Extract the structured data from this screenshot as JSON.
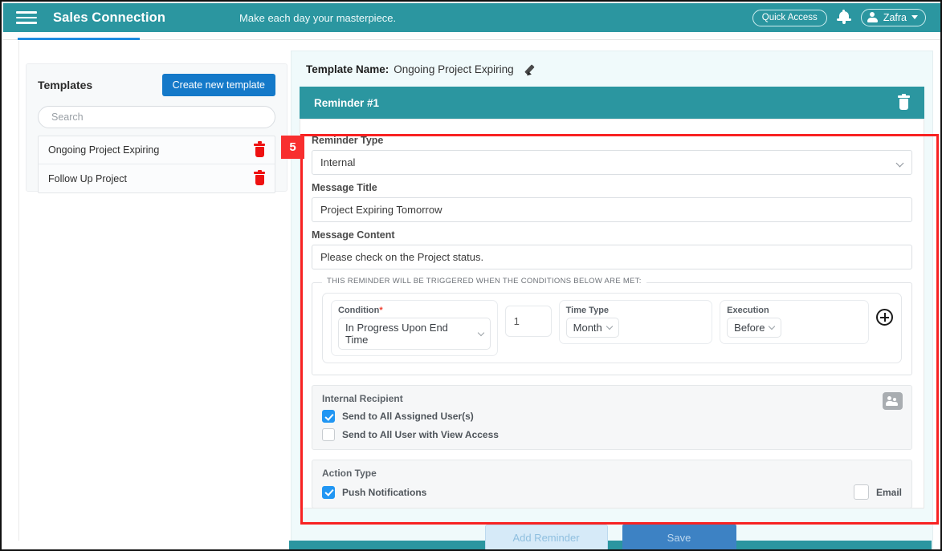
{
  "appbar": {
    "menu_icon": "hamburger-icon",
    "brand": "Sales Connection",
    "tagline": "Make each day your masterpiece.",
    "quick_access": "Quick Access",
    "bell_icon": "notification-bell-icon",
    "user_name": "Zafra",
    "teal": "#2b96a0"
  },
  "tabs": {
    "tab1": "",
    "tab2": ""
  },
  "templates": {
    "title": "Templates",
    "create_button": "Create new template",
    "search_placeholder": "Search",
    "search_value": "",
    "items": [
      {
        "name": "Ongoing Project Expiring"
      },
      {
        "name": "Follow Up Project"
      }
    ]
  },
  "annotation": {
    "badge": "5",
    "color": "#f82222"
  },
  "main": {
    "template_name_label": "Template Name:",
    "template_name_value": "Ongoing Project Expiring",
    "edit_icon": "pencil-icon",
    "reminder_title": "Reminder #1",
    "delete_icon": "trash-icon",
    "reminder_type_label": "Reminder Type",
    "reminder_type_value": "Internal",
    "message_title_label": "Message Title",
    "message_title_value": "Project Expiring Tomorrow",
    "message_content_label": "Message Content",
    "message_content_value": "Please check on the Project status.",
    "conditions": {
      "legend": "THIS REMINDER WILL BE TRIGGERED WHEN THE CONDITIONS BELOW ARE MET:",
      "condition_label": "Condition",
      "condition_required": "*",
      "condition_value": "In Progress Upon End Time",
      "amount_value": "1",
      "time_type_label": "Time Type",
      "time_type_value": "Month",
      "execution_label": "Execution",
      "execution_value": "Before",
      "add_icon": "plus-circle-icon"
    },
    "internal_recipient": {
      "title": "Internal Recipient",
      "add_user_icon": "add-users-icon",
      "options": [
        {
          "label": "Send to All Assigned User(s)",
          "checked": true
        },
        {
          "label": "Send to All User with View Access",
          "checked": false
        }
      ]
    },
    "action_type": {
      "title": "Action Type",
      "push_label": "Push Notifications",
      "push_checked": true,
      "email_label": "Email",
      "email_checked": false
    }
  },
  "footer": {
    "add_reminder": "Add Reminder",
    "save": "Save"
  }
}
